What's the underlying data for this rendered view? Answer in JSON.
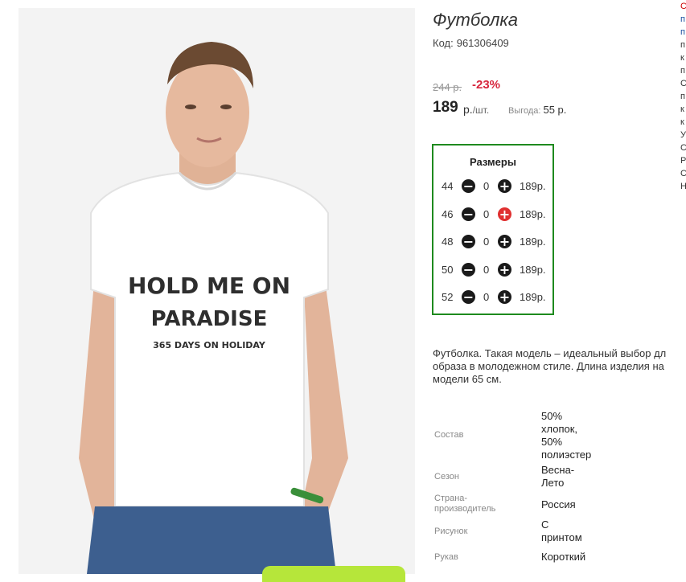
{
  "product": {
    "title": "Футболка",
    "code_label": "Код:",
    "code_value": "961306409",
    "old_price": "244 р.",
    "discount": "-23%",
    "price": "189",
    "price_unit": "р.",
    "per_unit": "/шт.",
    "benefit_label": "Выгода:",
    "benefit_value": "55 р."
  },
  "photo_print": {
    "line1": "HOLD ME ON",
    "line2": "PARADISE",
    "line3": "365 DAYS ON HOLIDAY"
  },
  "sizes": {
    "title": "Размеры",
    "rows": [
      {
        "size": "44",
        "qty": "0",
        "price": "189р."
      },
      {
        "size": "46",
        "qty": "0",
        "price": "189р."
      },
      {
        "size": "48",
        "qty": "0",
        "price": "189р."
      },
      {
        "size": "50",
        "qty": "0",
        "price": "189р."
      },
      {
        "size": "52",
        "qty": "0",
        "price": "189р."
      }
    ],
    "border_color": "#1e8a1e",
    "active_plus_color": "#e03030"
  },
  "description": {
    "line1": "Футболка. Такая модель – идеальный выбор дл",
    "line2": "образа в молодежном стиле. Длина изделия на",
    "line3": "модели 65 см."
  },
  "attributes": [
    {
      "label": "Состав",
      "value_lines": [
        "50%",
        "хлопок,",
        "50%",
        "полиэстер"
      ]
    },
    {
      "label": "Сезон",
      "value_lines": [
        "Весна-",
        "Лето"
      ]
    },
    {
      "label_lines": [
        "Страна-",
        "производитель"
      ],
      "value_lines": [
        "Россия"
      ]
    },
    {
      "label": "Рисунок",
      "value_lines": [
        "С",
        "принтом"
      ]
    },
    {
      "label": "Рукав",
      "value_lines": [
        "Короткий"
      ]
    }
  ],
  "side_column": [
    "С",
    "п",
    "п",
    "п",
    "к",
    "п",
    "С",
    "п",
    "к",
    "к",
    "У",
    "С",
    "Р",
    "С",
    "Н"
  ]
}
